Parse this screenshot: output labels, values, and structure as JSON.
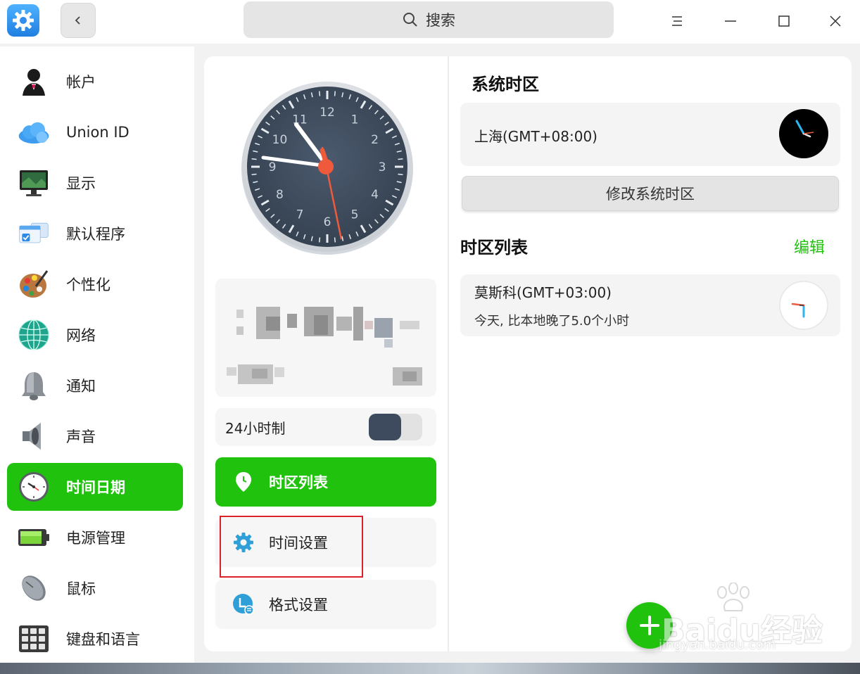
{
  "titlebar": {
    "search_label": "搜索",
    "app_icon": "gear-icon",
    "back_icon": "chevron-left-icon",
    "menu_icon": "hamburger-menu-icon",
    "minimize_icon": "minimize-icon",
    "maximize_icon": "maximize-icon",
    "close_icon": "close-icon"
  },
  "sidebar": {
    "items": [
      {
        "label": "帐户",
        "icon": "account-icon"
      },
      {
        "label": "Union ID",
        "icon": "cloud-icon"
      },
      {
        "label": "显示",
        "icon": "display-icon"
      },
      {
        "label": "默认程序",
        "icon": "default-apps-icon"
      },
      {
        "label": "个性化",
        "icon": "palette-icon"
      },
      {
        "label": "网络",
        "icon": "network-globe-icon"
      },
      {
        "label": "通知",
        "icon": "bell-icon"
      },
      {
        "label": "声音",
        "icon": "speaker-icon"
      },
      {
        "label": "时间日期",
        "icon": "clock-icon",
        "active": true
      },
      {
        "label": "电源管理",
        "icon": "battery-icon"
      },
      {
        "label": "鼠标",
        "icon": "mouse-icon"
      },
      {
        "label": "键盘和语言",
        "icon": "keyboard-icon"
      }
    ]
  },
  "clock": {
    "numerals": [
      "12",
      "1",
      "2",
      "3",
      "4",
      "5",
      "6",
      "7",
      "8",
      "9",
      "10",
      "11"
    ],
    "face_color": "#3d4b5e",
    "second_hand_color": "#f05a3c"
  },
  "datetime_card": {
    "content": "blurred"
  },
  "hour_format": {
    "label": "24小时制",
    "enabled": true
  },
  "menu": {
    "timezone_list_label": "时区列表",
    "time_settings_label": "时间设置",
    "format_settings_label": "格式设置"
  },
  "system_timezone": {
    "title": "系统时区",
    "city": "上海(GMT+08:00)",
    "modify_button": "修改系统时区"
  },
  "timezone_list": {
    "title": "时区列表",
    "edit_label": "编辑",
    "items": [
      {
        "city": "莫斯科(GMT+03:00)",
        "diff": "今天, 比本地晚了5.0个小时"
      }
    ]
  },
  "watermark": {
    "text": "Baidu经验",
    "url": "jingyan.baidu.com"
  },
  "colors": {
    "accent": "#20c20e",
    "highlight_border": "#d9222a"
  }
}
